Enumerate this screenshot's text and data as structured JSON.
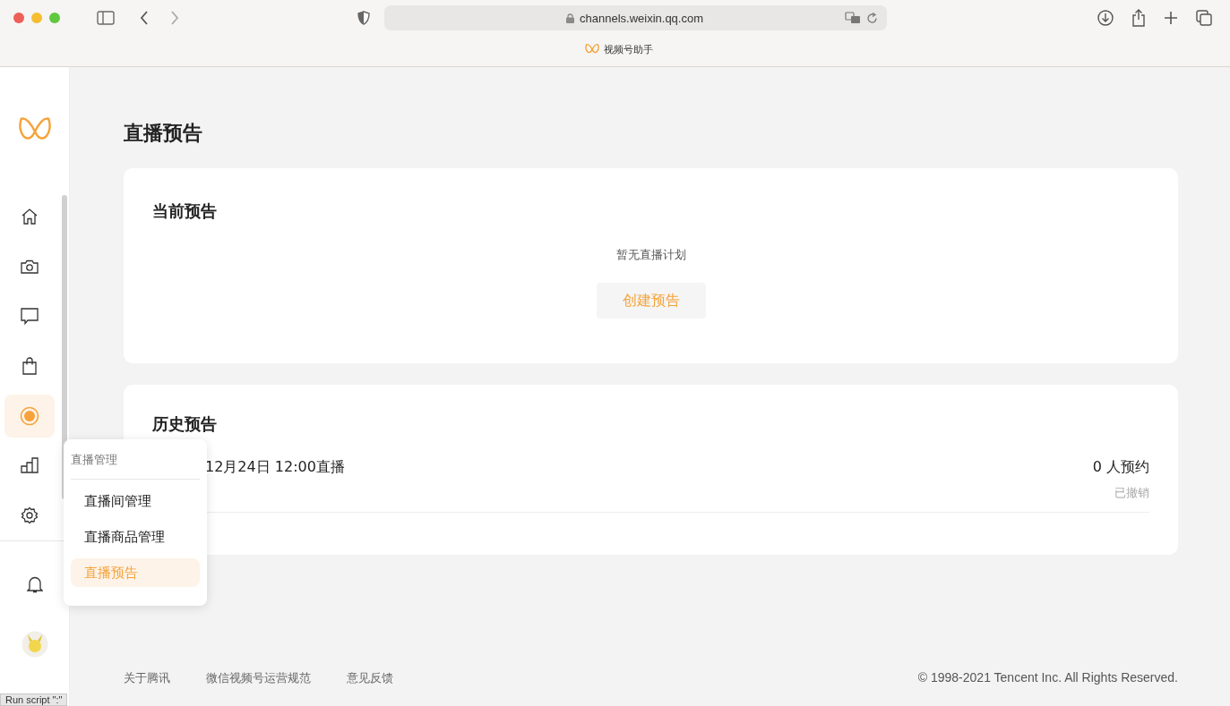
{
  "browser": {
    "url": "channels.weixin.qq.com",
    "tab_title": "视频号助手"
  },
  "sidebar": {
    "items": [
      {
        "kind": "home",
        "selected": false
      },
      {
        "kind": "camera",
        "selected": false
      },
      {
        "kind": "message",
        "selected": false
      },
      {
        "kind": "bag",
        "selected": false
      },
      {
        "kind": "live",
        "selected": true
      },
      {
        "kind": "chart",
        "selected": false
      },
      {
        "kind": "settings",
        "selected": false
      }
    ],
    "bottom": [
      {
        "kind": "bell"
      },
      {
        "kind": "avatar"
      }
    ]
  },
  "popup": {
    "title": "直播管理",
    "items": [
      {
        "label": "直播间管理",
        "selected": false
      },
      {
        "label": "直播商品管理",
        "selected": false
      },
      {
        "label": "直播预告",
        "selected": true
      }
    ]
  },
  "page_title": "直播预告",
  "current": {
    "title": "当前预告",
    "empty_text": "暂无直播计划",
    "button": "创建预告"
  },
  "history": {
    "title": "历史预告",
    "rows": [
      {
        "title": "12月24日 12:00直播",
        "count": "0 人预约",
        "status": "已撤销"
      }
    ]
  },
  "footer": {
    "links": [
      "关于腾讯",
      "微信视频号运营规范",
      "意见反馈"
    ],
    "copyright": "© 1998-2021 Tencent Inc. All Rights Reserved."
  },
  "status_bar": "Run script \":\""
}
